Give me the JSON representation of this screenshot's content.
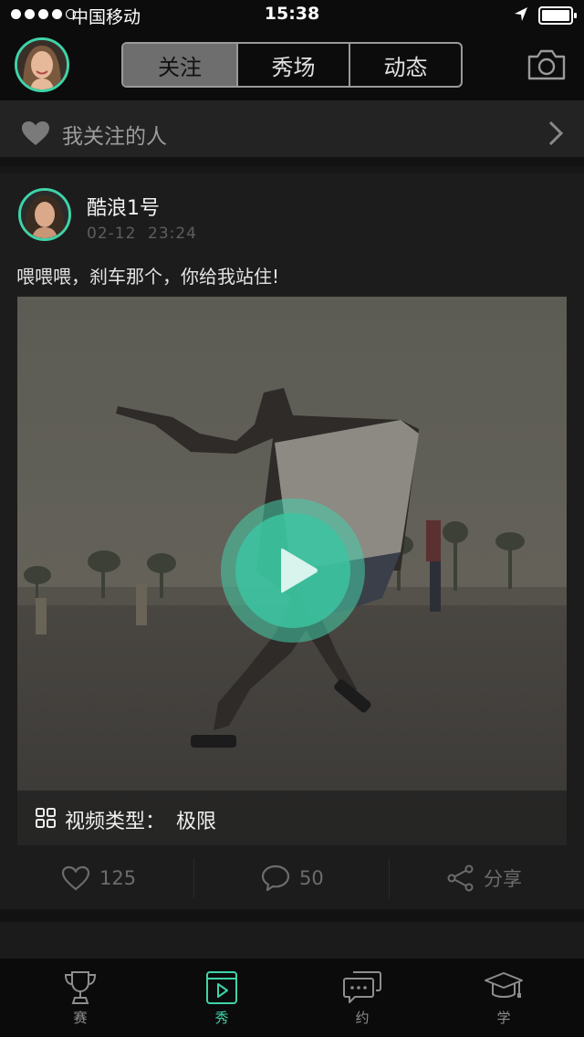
{
  "status_bar": {
    "carrier": "中国移动",
    "time": "15:38"
  },
  "header": {
    "tabs": [
      {
        "label": "关注",
        "active": true
      },
      {
        "label": "秀场",
        "active": false
      },
      {
        "label": "动态",
        "active": false
      }
    ]
  },
  "following_row": {
    "label": "我关注的人"
  },
  "post": {
    "user_name": "酷浪1号",
    "date": "02-12",
    "time": "23:24",
    "text": "喂喂喂，刹车那个，你给我站住!",
    "video_caption_label": "视频类型：",
    "video_caption_value": "极限",
    "like_count": "125",
    "comment_count": "50",
    "share_label": "分享"
  },
  "tab_bar": {
    "items": [
      {
        "label": "赛",
        "icon": "trophy-icon",
        "active": false
      },
      {
        "label": "秀",
        "icon": "play-square-icon",
        "active": true
      },
      {
        "label": "约",
        "icon": "chat-bubble-icon",
        "active": false
      },
      {
        "label": "学",
        "icon": "graduation-cap-icon",
        "active": false
      }
    ]
  },
  "colors": {
    "accent": "#3fd3a8",
    "background": "#171717",
    "header": "#0c0c0c"
  }
}
